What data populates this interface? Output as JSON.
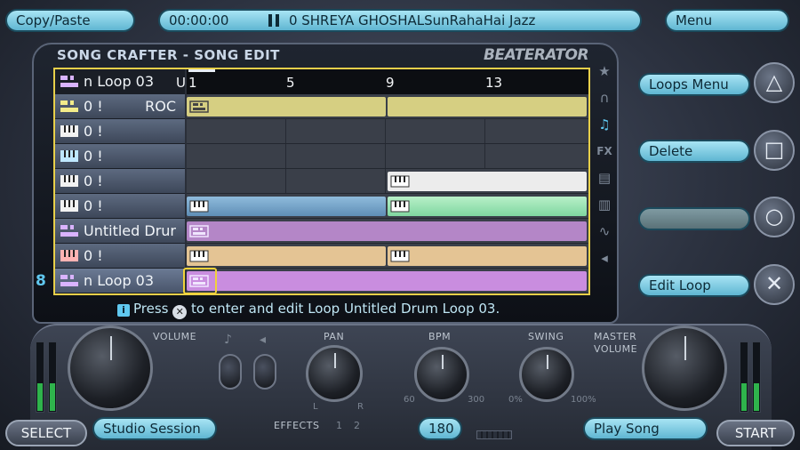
{
  "top": {
    "copy_paste": "Copy/Paste",
    "time": "00:00:00",
    "pause_icon": "pause-icon",
    "song_info": "0 SHREYA GHOSHALSunRahaHai Jazz",
    "menu": "Menu"
  },
  "screen": {
    "title": "SONG CRAFTER - SONG EDIT",
    "brand": "BEATERATOR",
    "header_track": "n Loop 03",
    "ruler_cut": "U",
    "ruler_ticks": [
      "1",
      "5",
      "9",
      "13"
    ],
    "tracks": [
      {
        "label": "0 !",
        "suffix": "ROC",
        "icon": "drum-loop-icon",
        "color": "#d6cf82"
      },
      {
        "label": "0 !",
        "suffix": "",
        "icon": "keyboard-icon",
        "color": ""
      },
      {
        "label": "0 !",
        "suffix": "",
        "icon": "keyboard-icon",
        "color": ""
      },
      {
        "label": "0 !",
        "suffix": "",
        "icon": "keyboard-icon",
        "color": "#e8e8e8"
      },
      {
        "label": "0 !",
        "suffix": "",
        "icon": "keyboard-icon",
        "color": "#79a9cf"
      },
      {
        "label": "Untitled Drur",
        "suffix": "",
        "icon": "drum-loop-icon",
        "color": "#b486c7"
      },
      {
        "label": "0 !",
        "suffix": "",
        "icon": "keyboard-icon",
        "color": "#e4c494"
      },
      {
        "label": "n Loop 03",
        "suffix": "",
        "icon": "drum-loop-icon",
        "color": "#c98ddf"
      }
    ],
    "hint_prefix": "Press",
    "hint_text": "to enter and edit Loop Untitled Drum Loop 03.",
    "tabs": [
      "star-icon",
      "headphones-icon",
      "music-note-icon",
      "fx-icon",
      "drum-loop-icon",
      "keyboard-icon",
      "wave-icon",
      "speaker-icon",
      "grid-icon"
    ],
    "track_number": "8"
  },
  "side": {
    "loops_menu": "Loops Menu",
    "delete": "Delete",
    "blank": "",
    "edit_loop": "Edit Loop",
    "triangle": "△",
    "square": "□",
    "circle": "○",
    "cross": "✕"
  },
  "bottom": {
    "volume_label": "VOLUME",
    "pan_label": "PAN",
    "pan_l": "L",
    "pan_r": "R",
    "bpm_label": "BPM",
    "bpm_min": "60",
    "bpm_max": "300",
    "swing_label": "SWING",
    "swing_min": "0%",
    "swing_max": "100%",
    "master_label_1": "MASTER",
    "master_label_2": "VOLUME",
    "effects_label": "EFFECTS",
    "effects_1": "1",
    "effects_2": "2",
    "select": "SELECT",
    "studio_session": "Studio Session",
    "bpm_value": "180",
    "play_song": "Play Song",
    "start": "START"
  }
}
